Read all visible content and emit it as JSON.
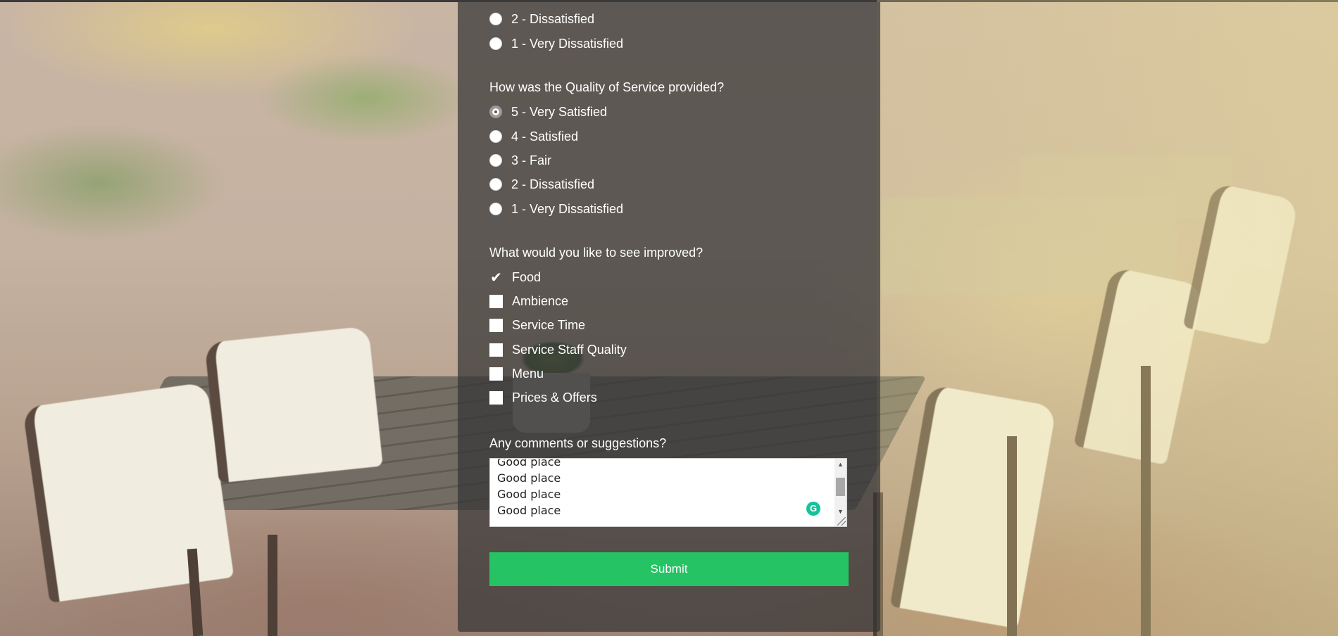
{
  "form": {
    "prev_question_tail": [
      {
        "label": "2 - Dissatisfied",
        "checked": false
      },
      {
        "label": "1 - Very Dissatisfied",
        "checked": false
      }
    ],
    "service_question": {
      "label": "How was the Quality of Service provided?",
      "options": [
        {
          "label": "5 - Very Satisfied",
          "checked": true
        },
        {
          "label": "4 - Satisfied",
          "checked": false
        },
        {
          "label": "3 - Fair",
          "checked": false
        },
        {
          "label": "2 - Dissatisfied",
          "checked": false
        },
        {
          "label": "1 - Very Dissatisfied",
          "checked": false
        }
      ]
    },
    "improve_question": {
      "label": "What would you like to see improved?",
      "options": [
        {
          "label": "Food",
          "checked": true
        },
        {
          "label": "Ambience",
          "checked": false
        },
        {
          "label": "Service Time",
          "checked": false
        },
        {
          "label": "Service Staff Quality",
          "checked": false
        },
        {
          "label": "Menu",
          "checked": false
        },
        {
          "label": "Prices & Offers",
          "checked": false
        }
      ]
    },
    "comments": {
      "label": "Any comments or suggestions?",
      "lines": [
        "Good place",
        "Good place",
        "Good place",
        "Good place"
      ]
    },
    "submit_label": "Submit"
  },
  "icons": {
    "scroll_up": "scroll-up-arrow-icon",
    "scroll_down": "scroll-down-arrow-icon",
    "resize": "resize-grip-icon",
    "grammarly": "grammarly-icon",
    "check": "checkmark-icon"
  },
  "colors": {
    "submit_bg": "#25c364",
    "panel_bg": "rgba(52,52,52,0.72)",
    "grammarly": "#15c39a"
  }
}
